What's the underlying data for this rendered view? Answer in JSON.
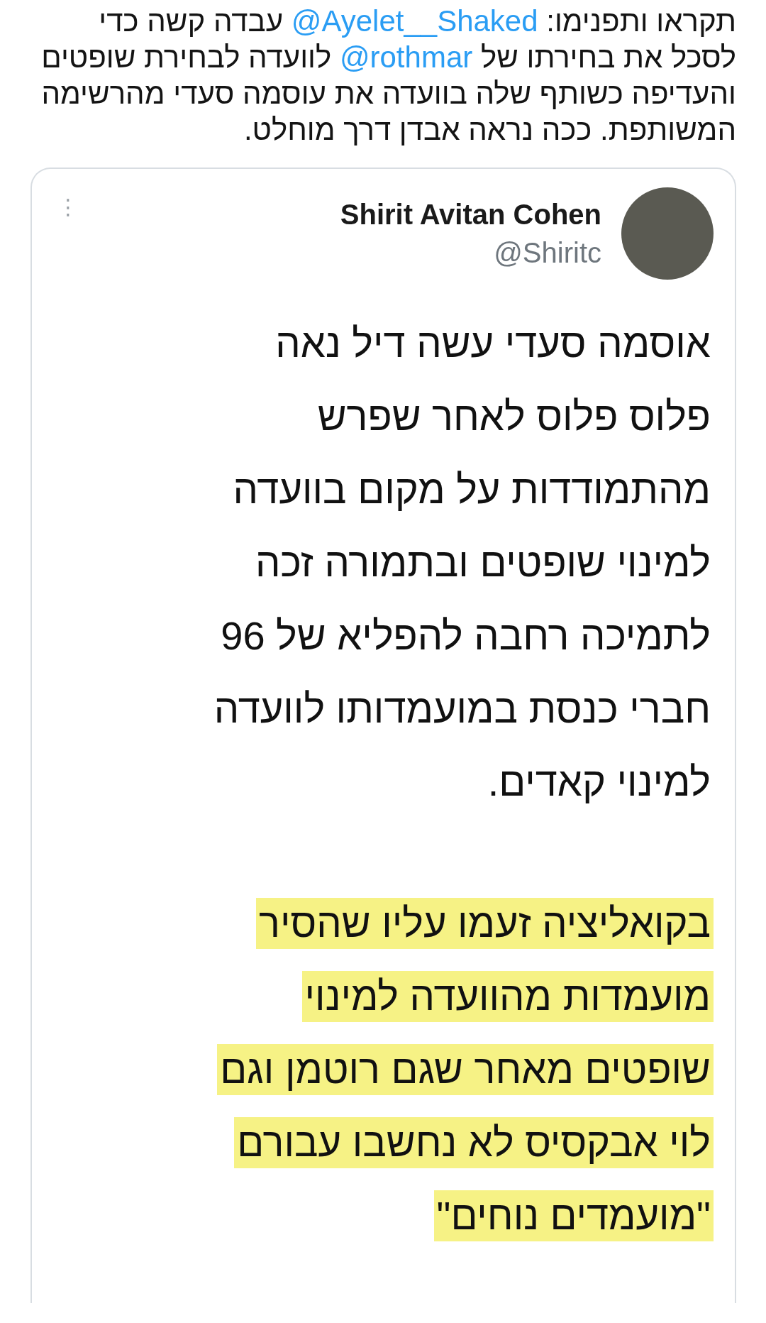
{
  "tweet": {
    "segments": [
      {
        "kind": "text",
        "text": "תקראו ותפנימו: "
      },
      {
        "kind": "mention",
        "text": "@Ayelet__Shaked"
      },
      {
        "kind": "text",
        "text": " עבדה קשה כדי לסכל את בחירתו של "
      },
      {
        "kind": "mention",
        "text": "@rothmar"
      },
      {
        "kind": "text",
        "text": " לוועדה לבחירת שופטים והעדיפה כשותף שלה בוועדה את עוסמה סעדי מהרשימה המשותפת. ככה נראה אבדן דרך מוחלט."
      }
    ]
  },
  "quoted": {
    "name": "Shirit Avitan Cohen",
    "handle": "@Shiritc",
    "menu": "⋮",
    "lines": [
      {
        "text": "אוסמה סעדי עשה דיל נאה",
        "highlighted": false
      },
      {
        "text": "פלוס פלוס לאחר שפרש",
        "highlighted": false
      },
      {
        "text": "מהתמודדות על מקום בוועדה",
        "highlighted": false
      },
      {
        "text": "למינוי שופטים ובתמורה זכה",
        "highlighted": false
      },
      {
        "text": "לתמיכה רחבה להפליא של 96",
        "highlighted": false
      },
      {
        "text": "חברי כנסת במועמדותו לוועדה",
        "highlighted": false
      },
      {
        "text": "למינוי קאדים.",
        "highlighted": false
      },
      {
        "text": "בקואליציה זעמו עליו שהסיר",
        "highlighted": true
      },
      {
        "text": "מועמדות מהוועדה למינוי",
        "highlighted": true
      },
      {
        "text": "שופטים מאחר שגם רוטמן וגם",
        "highlighted": true
      },
      {
        "text": "לוי אבקסיס לא נחשבו עבורם",
        "highlighted": true
      },
      {
        "text": "\"מועמדים נוחים\"",
        "highlighted": true
      }
    ]
  }
}
